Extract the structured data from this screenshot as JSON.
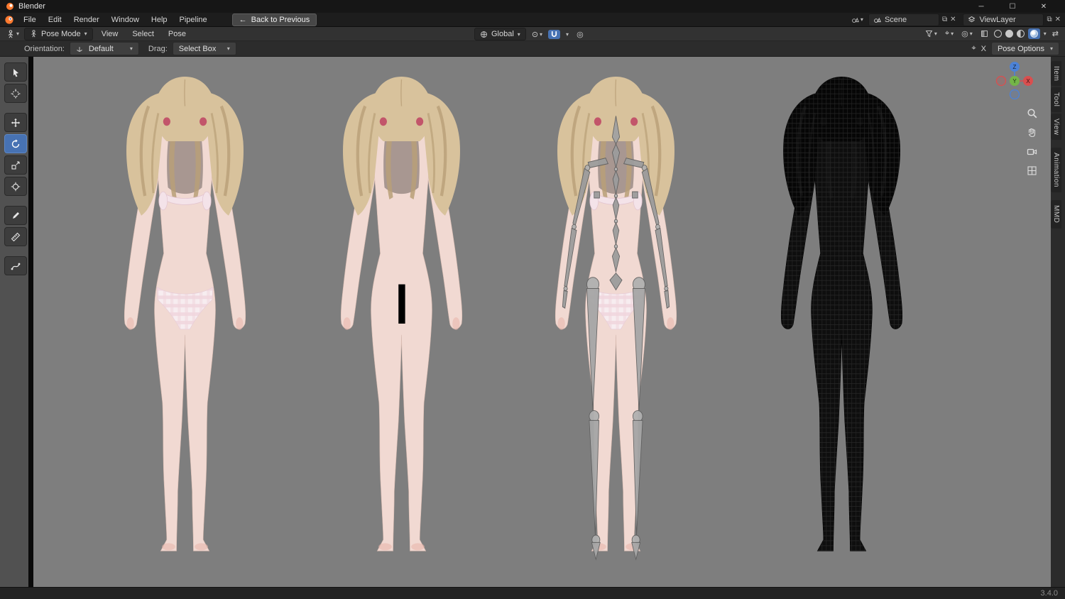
{
  "window": {
    "title": "Blender"
  },
  "icons": {
    "caret": "▾",
    "back_arrow": "←",
    "minimize": "─",
    "maximize": "☐",
    "close": "✕",
    "unlink_x": "✕",
    "copy": "⧉",
    "swap": "⇄",
    "pivot": "⊙",
    "proportional": "◎",
    "overlays": "◎",
    "grid_box": "⊞",
    "keymap_icon": "⌖"
  },
  "menubar": {
    "menus": [
      "File",
      "Edit",
      "Render",
      "Window",
      "Help",
      "Pipeline"
    ],
    "back_button": "Back to Previous",
    "scene": {
      "label": "Scene"
    },
    "viewlayer": {
      "label": "ViewLayer"
    }
  },
  "viewport_header": {
    "mode_label": "Pose Mode",
    "menus": [
      "View",
      "Select",
      "Pose"
    ],
    "orientation_label": "Global"
  },
  "tool_settings": {
    "orientation_label": "Orientation:",
    "orientation_value": "Default",
    "drag_label": "Drag:",
    "drag_value": "Select Box",
    "keymap_x": "X",
    "pose_options": "Pose Options"
  },
  "sidebar_tabs": [
    "Item",
    "Tool",
    "View",
    "Animation",
    "MMD"
  ],
  "nav_gizmo": {
    "x": "X",
    "y": "Y",
    "z": "Z"
  },
  "statusbar": {
    "version": "3.4.0"
  },
  "colors": {
    "accent": "#4772b3",
    "viewport_bg": "#7e7e7e",
    "header_bg": "#323232",
    "menubar_bg": "#1d1d1d",
    "titlebar_bg": "#161616",
    "statusbar_bg": "#232323",
    "skin_tone": "#f1d9d2",
    "hair_blonde": "#d8c29c",
    "underwear_pink": "#f0d4dc",
    "bone_gray": "#9c9c9c",
    "wireframe_black": "#0e0e0e",
    "axis_x": "#d94f4f",
    "axis_y": "#74b648",
    "axis_z": "#4d82d6"
  }
}
